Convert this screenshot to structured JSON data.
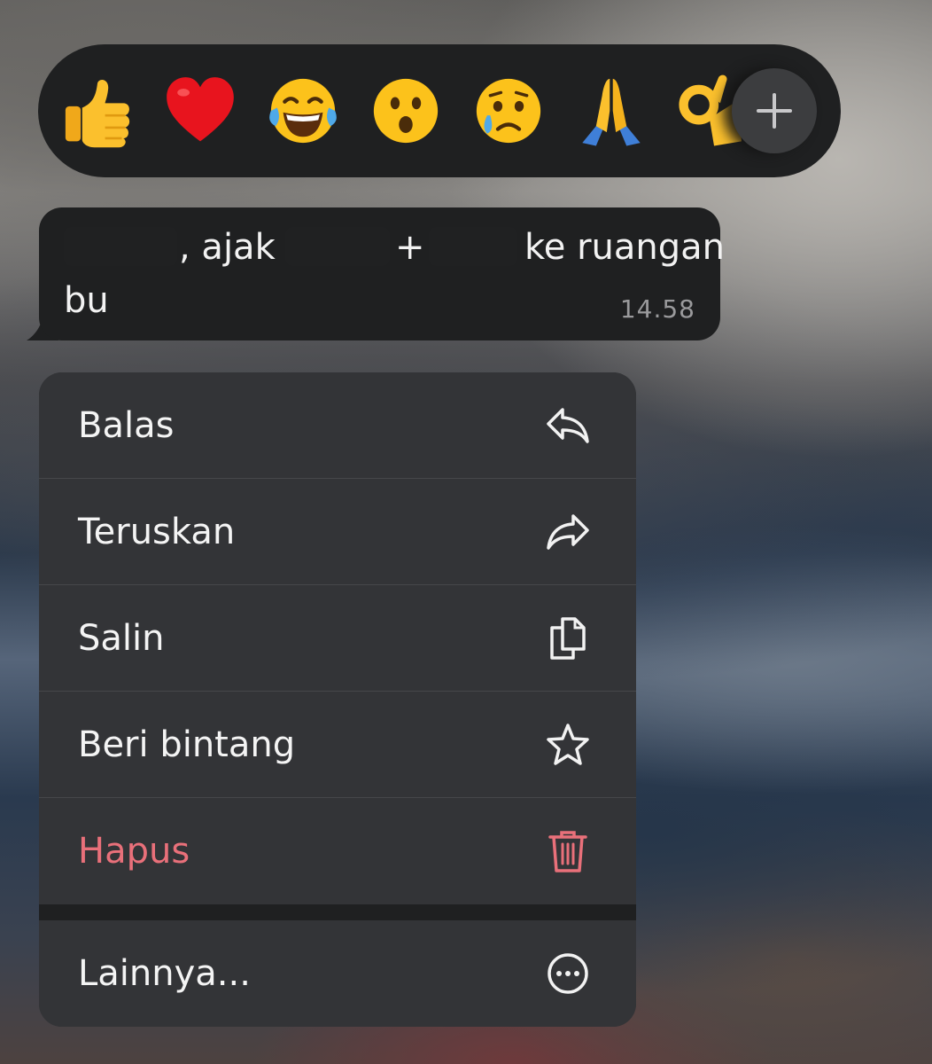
{
  "reactions": {
    "emojis": [
      {
        "name": "thumbs-up",
        "char": "👍"
      },
      {
        "name": "red-heart",
        "char": "❤️"
      },
      {
        "name": "tears-of-joy",
        "char": "😂"
      },
      {
        "name": "surprised-face",
        "char": "😮"
      },
      {
        "name": "crying-face",
        "char": "😢"
      },
      {
        "name": "folded-hands",
        "char": "🙏"
      },
      {
        "name": "ok-hand",
        "char": "👌"
      }
    ],
    "more_icon": "plus-icon"
  },
  "message": {
    "part1": ", ajak",
    "part2": "+",
    "part3": "ke ruangan",
    "line2": "bu",
    "time": "14.58"
  },
  "menu": {
    "items": [
      {
        "label": "Balas",
        "icon": "reply-icon"
      },
      {
        "label": "Teruskan",
        "icon": "forward-icon"
      },
      {
        "label": "Salin",
        "icon": "copy-icon"
      },
      {
        "label": "Beri bintang",
        "icon": "star-icon"
      },
      {
        "label": "Hapus",
        "icon": "trash-icon"
      }
    ],
    "more": {
      "label": "Lainnya...",
      "icon": "more-icon"
    }
  },
  "colors": {
    "danger": "#e9707a",
    "panel": "#1f2021",
    "menu_item": "#333437"
  }
}
